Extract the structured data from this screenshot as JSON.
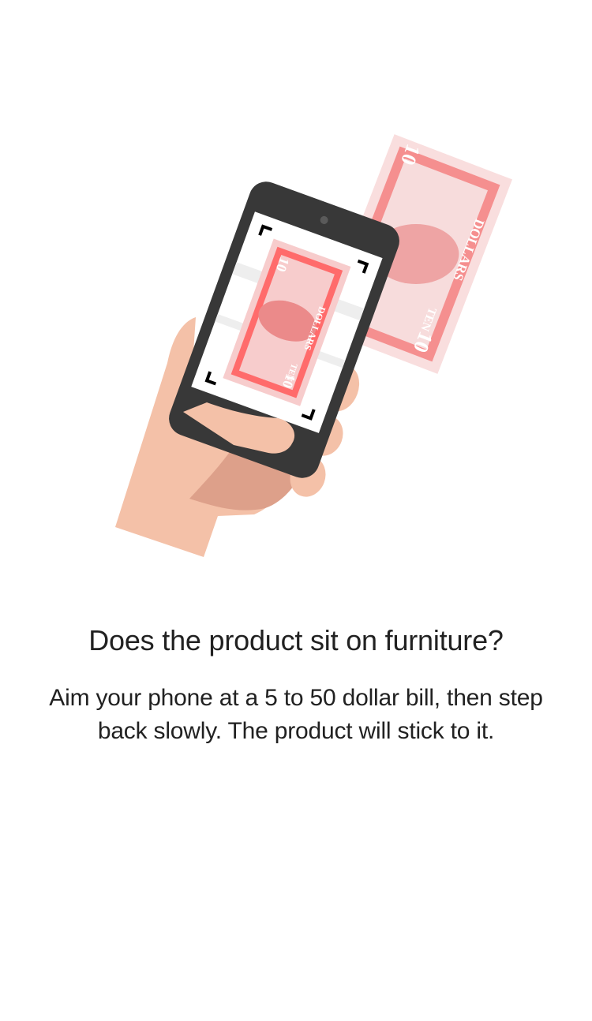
{
  "illustration": {
    "name": "phone-scanning-dollar-bill",
    "bill_large": {
      "number_top": "10",
      "number_bottom": "10",
      "word_right": "DOLLARS",
      "word_left": "TEN"
    },
    "bill_screen": {
      "number_top": "10",
      "number_bottom": "10",
      "word_right": "DOLLARS",
      "word_left": "TEN"
    },
    "colors": {
      "bill_red": "#f27878",
      "bill_pale": "#f7dcdc",
      "bill_mid": "#eea4a4",
      "phone_body": "#383838",
      "skin": "#f4c1a8",
      "skin_shadow": "#dda08a"
    }
  },
  "content": {
    "title": "Does the product sit on furniture?",
    "body": "Aim your phone at a 5 to 50 dollar bill, then step back slowly. The product will stick to it."
  }
}
